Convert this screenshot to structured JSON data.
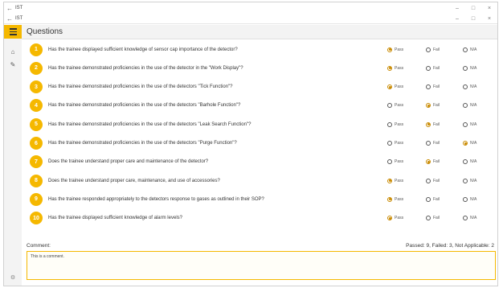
{
  "window": {
    "back1": "←",
    "back2": "←",
    "title1": "IST",
    "title2": "IST",
    "controls": [
      "–",
      "□",
      "×"
    ]
  },
  "header": {
    "title": "Questions"
  },
  "options": {
    "pass": "Pass",
    "fail": "Fail",
    "na": "N/A"
  },
  "questions": [
    {
      "num": "1",
      "text": "Has the trainee displayed sufficient knowledge of sensor cap importance of the detector?",
      "selected": "pass"
    },
    {
      "num": "2",
      "text": "Has the trainee demonstrated proficiencies in the use of the detector in the \"Work Display\"?",
      "selected": "pass"
    },
    {
      "num": "3",
      "text": "Has the trainee demonstrated proficiencies in the use of the detectors \"Tick Function\"?",
      "selected": "pass"
    },
    {
      "num": "4",
      "text": "Has the trainee demonstrated proficiencies in the use of the detectors \"Barhole Function\"?",
      "selected": "fail"
    },
    {
      "num": "5",
      "text": "Has the trainee demonstrated proficiencies in the use of the detectors \"Leak Search Function\"?",
      "selected": "fail"
    },
    {
      "num": "6",
      "text": "Has the trainee demonstrated proficiencies in the use of the detectors \"Purge Function\"?",
      "selected": "na"
    },
    {
      "num": "7",
      "text": "Does the trainee understand proper care and maintenance of the detector?",
      "selected": "fail"
    },
    {
      "num": "8",
      "text": "Does the trainee understand proper care, maintenance, and use of accessories?",
      "selected": "pass"
    },
    {
      "num": "9",
      "text": "Has the trainee responded appropriately to the detectors response to gases as outlined in their SOP?",
      "selected": "pass"
    },
    {
      "num": "10",
      "text": "Has the trainee displayed sufficient knowledge of alarm levels?",
      "selected": "pass"
    }
  ],
  "footer": {
    "comment_label": "Comment:",
    "summary": "Passed: 9, Failed: 3, Not Applicable: 2"
  },
  "comment": {
    "value": "This is a comment."
  },
  "colors": {
    "accent": "#f5b800",
    "selected_dot": "#c98a00"
  },
  "icons": {
    "rail_home": "home-icon",
    "rail_pin": "pin-icon",
    "rail_settings": "settings-icon"
  }
}
